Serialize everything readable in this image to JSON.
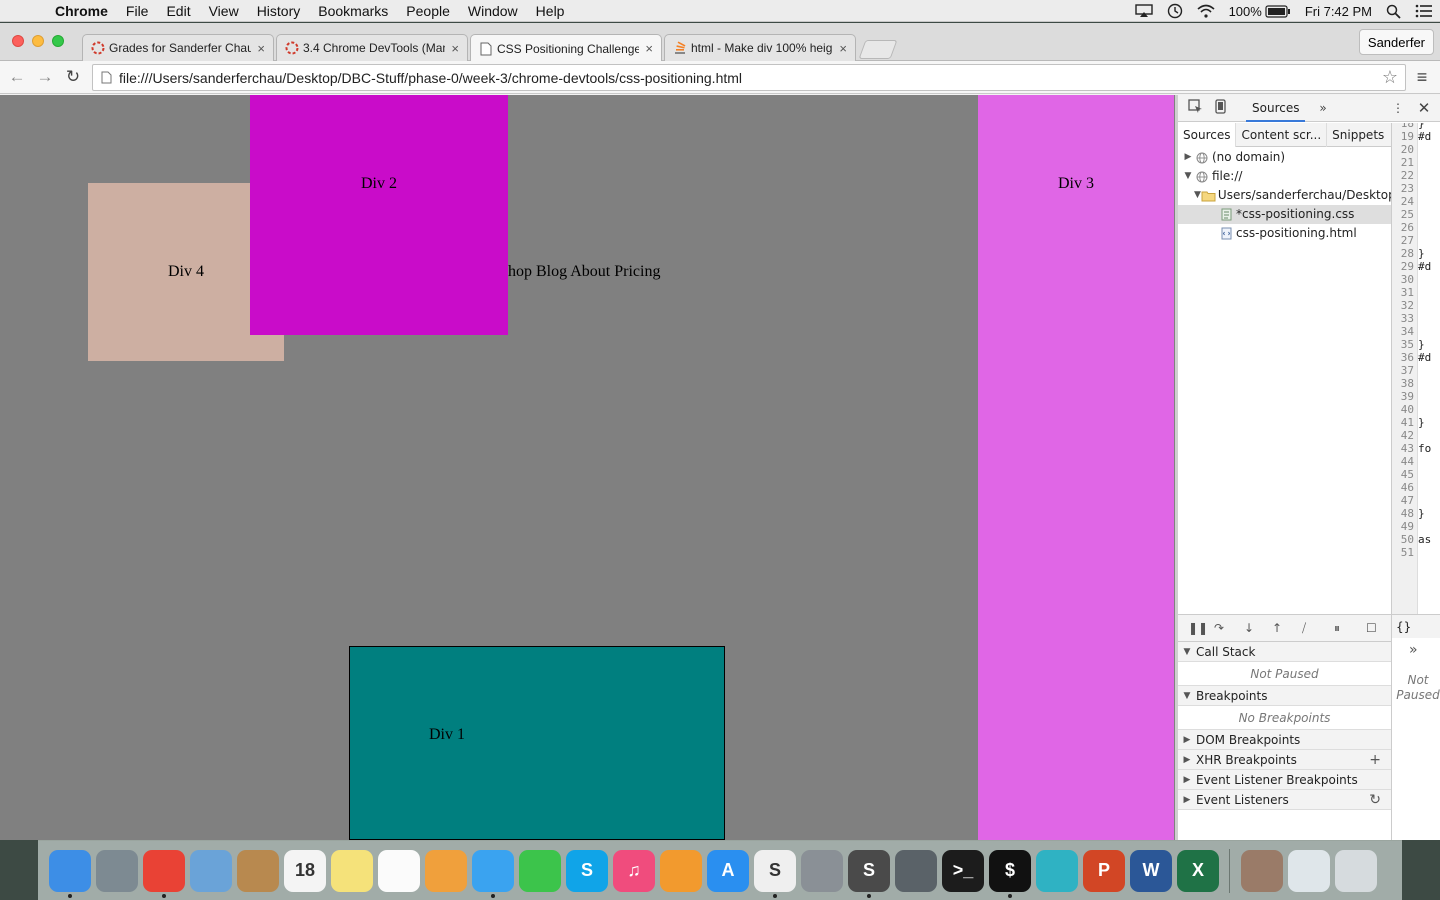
{
  "menubar": {
    "app": "Chrome",
    "items": [
      "File",
      "Edit",
      "View",
      "History",
      "Bookmarks",
      "People",
      "Window",
      "Help"
    ],
    "battery": "100%",
    "clock": "Fri 7:42 PM"
  },
  "browser": {
    "tabs": [
      {
        "title": "Grades for Sanderfer Chau",
        "icon": "loading-icon"
      },
      {
        "title": "3.4 Chrome DevTools (Man",
        "icon": "loading-icon"
      },
      {
        "title": "CSS Positioning Challenge",
        "icon": "document-icon"
      },
      {
        "title": "html - Make div 100% heig",
        "icon": "stackoverflow-icon"
      }
    ],
    "profile": "Sanderfer",
    "url": "file:///Users/sanderferchau/Desktop/DBC-Stuff/phase-0/week-3/chrome-devtools/css-positioning.html"
  },
  "page": {
    "div1": "Div 1",
    "div2": "Div 2",
    "div3": "Div 3",
    "div4": "Div 4",
    "nav_text": "hop Blog About Pricing",
    "colors": {
      "background": "#808080",
      "div1": "#007f7f",
      "div2": "#c90cc9",
      "div3": "#e066e6",
      "div4": "#cdafa2"
    }
  },
  "devtools": {
    "panel_tab": "Sources",
    "sub_tabs": [
      "Sources",
      "Content scr...",
      "Snippets"
    ],
    "tree": [
      {
        "label": "(no domain)",
        "arrow": "▶",
        "icon": "globe-icon",
        "indent": 0
      },
      {
        "label": "file://",
        "arrow": "▼",
        "icon": "globe-icon",
        "indent": 0
      },
      {
        "label": "Users/sanderferchau/Desktop",
        "arrow": "▼",
        "icon": "folder-icon",
        "indent": 1
      },
      {
        "label": "*css-positioning.css",
        "arrow": "",
        "icon": "css-file-icon",
        "indent": 2,
        "selected": true
      },
      {
        "label": "css-positioning.html",
        "arrow": "",
        "icon": "html-file-icon",
        "indent": 2
      }
    ],
    "code_lines": [
      {
        "n": "18",
        "c": "}"
      },
      {
        "n": "19",
        "c": "#d"
      },
      {
        "n": "20",
        "c": ""
      },
      {
        "n": "21",
        "c": ""
      },
      {
        "n": "22",
        "c": ""
      },
      {
        "n": "23",
        "c": ""
      },
      {
        "n": "24",
        "c": ""
      },
      {
        "n": "25",
        "c": ""
      },
      {
        "n": "26",
        "c": ""
      },
      {
        "n": "27",
        "c": ""
      },
      {
        "n": "28",
        "c": "}"
      },
      {
        "n": "29",
        "c": "#d"
      },
      {
        "n": "30",
        "c": ""
      },
      {
        "n": "31",
        "c": ""
      },
      {
        "n": "32",
        "c": ""
      },
      {
        "n": "33",
        "c": ""
      },
      {
        "n": "34",
        "c": ""
      },
      {
        "n": "35",
        "c": "}"
      },
      {
        "n": "36",
        "c": "#d"
      },
      {
        "n": "37",
        "c": ""
      },
      {
        "n": "38",
        "c": ""
      },
      {
        "n": "39",
        "c": ""
      },
      {
        "n": "40",
        "c": ""
      },
      {
        "n": "41",
        "c": "}"
      },
      {
        "n": "42",
        "c": ""
      },
      {
        "n": "43",
        "c": "fo"
      },
      {
        "n": "44",
        "c": ""
      },
      {
        "n": "45",
        "c": ""
      },
      {
        "n": "46",
        "c": ""
      },
      {
        "n": "47",
        "c": ""
      },
      {
        "n": "48",
        "c": "}"
      },
      {
        "n": "49",
        "c": ""
      },
      {
        "n": "50",
        "c": "as"
      },
      {
        "n": "51",
        "c": ""
      }
    ],
    "editor_footer": "{}",
    "not_paused_side": "Not Paused",
    "panes": [
      {
        "label": "Call Stack",
        "arrow": "▼",
        "body": "Not Paused",
        "action": ""
      },
      {
        "label": "Breakpoints",
        "arrow": "▼",
        "body": "No Breakpoints",
        "action": ""
      },
      {
        "label": "DOM Breakpoints",
        "arrow": "▶",
        "body": "",
        "action": ""
      },
      {
        "label": "XHR Breakpoints",
        "arrow": "▶",
        "body": "",
        "action": "+"
      },
      {
        "label": "Event Listener Breakpoints",
        "arrow": "▶",
        "body": "",
        "action": ""
      },
      {
        "label": "Event Listeners",
        "arrow": "▶",
        "body": "",
        "action": "↻"
      }
    ]
  },
  "dock": {
    "apps": [
      {
        "name": "finder-icon",
        "label": "",
        "color": "#3d8ee6",
        "running": true
      },
      {
        "name": "launchpad-icon",
        "label": "",
        "color": "#7d8a92",
        "running": false
      },
      {
        "name": "chrome-icon",
        "label": "",
        "color": "#e94235",
        "running": true
      },
      {
        "name": "mail-icon",
        "label": "",
        "color": "#6aa3d8",
        "running": false
      },
      {
        "name": "contacts-icon",
        "label": "",
        "color": "#b8894f",
        "running": false
      },
      {
        "name": "calendar-icon",
        "label": "18",
        "color": "#f4f4f4",
        "running": false
      },
      {
        "name": "notes-icon",
        "label": "",
        "color": "#f5e27a",
        "running": false
      },
      {
        "name": "reminders-icon",
        "label": "",
        "color": "#fbfbfb",
        "running": false
      },
      {
        "name": "photos-icon",
        "label": "",
        "color": "#f0a03c",
        "running": false
      },
      {
        "name": "messages-icon",
        "label": "",
        "color": "#3aa3f0",
        "running": true
      },
      {
        "name": "facetime-icon",
        "label": "",
        "color": "#3cc44b",
        "running": false
      },
      {
        "name": "skype-icon",
        "label": "S",
        "color": "#10a4e8",
        "running": false
      },
      {
        "name": "itunes-icon",
        "label": "♫",
        "color": "#f04c7d",
        "running": false
      },
      {
        "name": "ibooks-icon",
        "label": "",
        "color": "#f29a2e",
        "running": false
      },
      {
        "name": "app-store-icon",
        "label": "A",
        "color": "#2a8ff0",
        "running": false
      },
      {
        "name": "slack-icon",
        "label": "S",
        "color": "#efefef",
        "running": true
      },
      {
        "name": "system-preferences-icon",
        "label": "",
        "color": "#8a9096",
        "running": false
      },
      {
        "name": "sublime-text-icon",
        "label": "S",
        "color": "#4a4a4a",
        "running": true
      },
      {
        "name": "gitx-icon",
        "label": "",
        "color": "#5a6268",
        "running": false
      },
      {
        "name": "terminal-icon",
        "label": ">_",
        "color": "#1c1c1c",
        "running": false
      },
      {
        "name": "terminal-running-icon",
        "label": "$",
        "color": "#111111",
        "running": true
      },
      {
        "name": "hipchat-icon",
        "label": "",
        "color": "#2fb2c3",
        "running": false
      },
      {
        "name": "powerpoint-icon",
        "label": "P",
        "color": "#d24625",
        "running": false
      },
      {
        "name": "word-icon",
        "label": "W",
        "color": "#2b5797",
        "running": false
      },
      {
        "name": "excel-icon",
        "label": "X",
        "color": "#1f7246",
        "running": false
      }
    ],
    "right": [
      {
        "name": "user-photo-icon",
        "label": "",
        "color": "#9a7b68"
      },
      {
        "name": "downloads-stack-icon",
        "label": "",
        "color": "#dfe6ea"
      },
      {
        "name": "trash-icon",
        "label": "",
        "color": "#d6dbde"
      }
    ]
  }
}
